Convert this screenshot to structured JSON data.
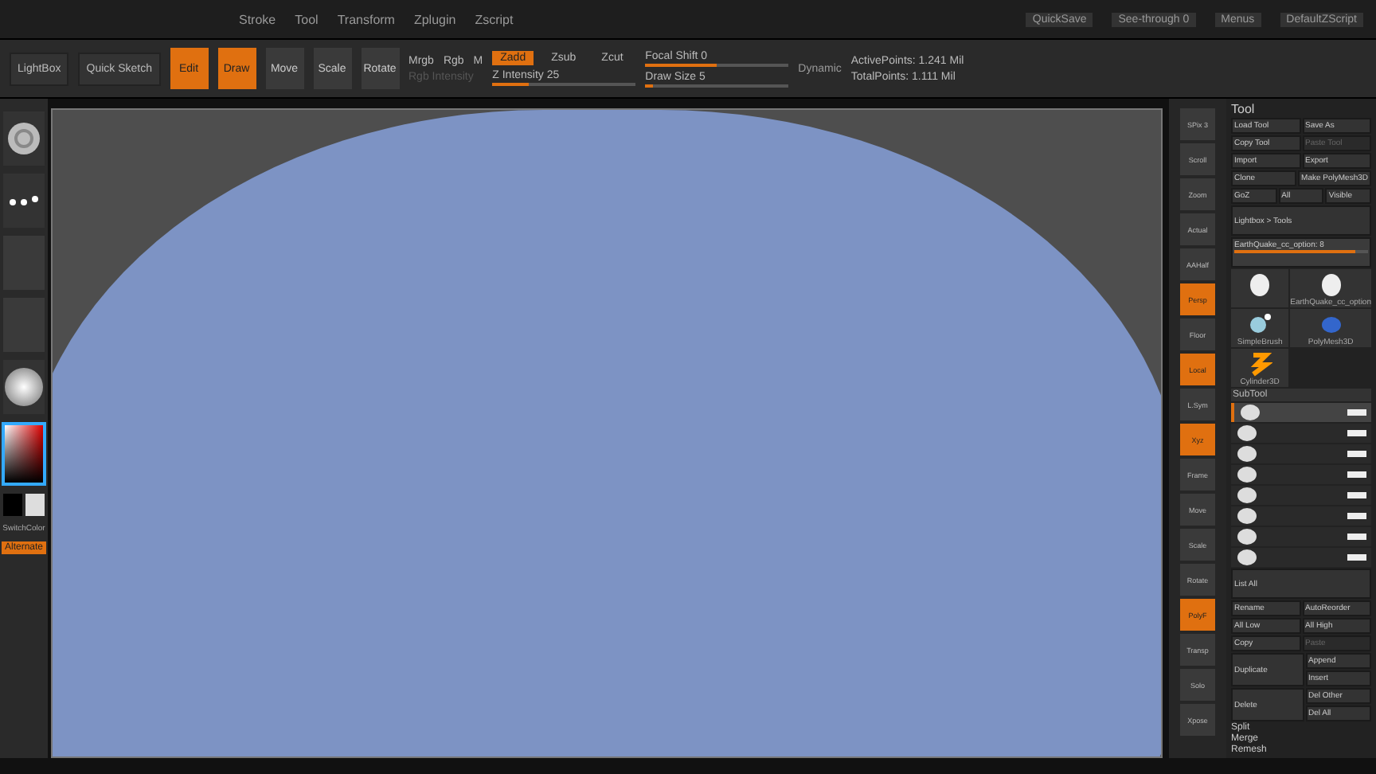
{
  "menu_bar": {
    "items": [
      "Stroke",
      "Tool",
      "Transform",
      "Zplugin",
      "Zscript"
    ],
    "right_items": [
      "QuickSave",
      "See-through 0",
      "Menus",
      "DefaultZScript"
    ]
  },
  "toolbar": {
    "home_buttons": [
      "LightBox",
      "Quick Sketch"
    ],
    "modes": [
      {
        "label": "Edit",
        "selected": true
      },
      {
        "label": "Draw",
        "selected": true
      },
      {
        "label": "Move",
        "selected": false
      },
      {
        "label": "Scale",
        "selected": false
      },
      {
        "label": "Rotate",
        "selected": false
      }
    ],
    "color_modes": [
      {
        "label": "Mrgb",
        "disabled": false
      },
      {
        "label": "Rgb",
        "disabled": false
      },
      {
        "label": "M",
        "disabled": false
      }
    ],
    "rgb_intensity": {
      "label": "Rgb Intensity",
      "disabled": true
    },
    "depth_modes": [
      {
        "label": "Zadd",
        "selected": true
      },
      {
        "label": "Zsub",
        "selected": false
      },
      {
        "label": "Zcut",
        "selected": false
      }
    ],
    "sliders": [
      {
        "label": "Focal Shift 0",
        "level": 0.5
      },
      {
        "label": "Z Intensity 25",
        "level": 0.25
      },
      {
        "label": "Draw Size 5",
        "level": 0.05
      }
    ],
    "dynamic": "Dynamic",
    "stats": [
      "ActivePoints: 1.241 Mil",
      "TotalPoints: 1.111 Mil"
    ]
  },
  "left_shelf": {
    "items": [
      {
        "kind": "brush"
      },
      {
        "kind": "stroke"
      },
      {
        "kind": "alpha"
      },
      {
        "kind": "texture"
      },
      {
        "kind": "material"
      },
      {
        "kind": "color"
      },
      {
        "kind": "swatches"
      }
    ],
    "switch_label": "SwitchColor",
    "alternate": "Alternate"
  },
  "right_shelf": {
    "buttons": [
      {
        "label": "SPix 3",
        "selected": false
      },
      {
        "label": "Scroll",
        "selected": false
      },
      {
        "label": "Zoom",
        "selected": false
      },
      {
        "label": "Actual",
        "selected": false
      },
      {
        "label": "AAHalf",
        "selected": false
      },
      {
        "label": "Persp",
        "selected": true
      },
      {
        "label": "Floor",
        "selected": false
      },
      {
        "label": "Local",
        "selected": true
      },
      {
        "label": "L.Sym",
        "selected": false
      },
      {
        "label": "Xyz",
        "selected": true
      },
      {
        "label": "Frame",
        "selected": false
      },
      {
        "label": "Move",
        "selected": false
      },
      {
        "label": "Scale",
        "selected": false
      },
      {
        "label": "Rotate",
        "selected": false
      },
      {
        "label": "PolyF",
        "selected": true
      },
      {
        "label": "Transp",
        "selected": false
      },
      {
        "label": "Solo",
        "selected": false
      },
      {
        "label": "Xpose",
        "selected": false
      }
    ]
  },
  "tool_panel": {
    "title": "Tool",
    "buttons": [
      [
        {
          "label": "Load Tool",
          "disabled": false
        },
        {
          "label": "Save As",
          "disabled": false
        }
      ],
      [
        {
          "label": "Copy Tool",
          "disabled": false
        },
        {
          "label": "Paste Tool",
          "disabled": true
        }
      ],
      [
        {
          "label": "Import",
          "disabled": false
        },
        {
          "label": "Export",
          "disabled": false
        }
      ],
      [
        {
          "label": "Clone",
          "disabled": false
        },
        {
          "label": "Make PolyMesh3D",
          "disabled": false
        }
      ],
      [
        {
          "label": "GoZ",
          "disabled": false
        },
        {
          "label": "All",
          "disabled": false
        },
        {
          "label": "Visible",
          "disabled": false
        }
      ]
    ],
    "lightbox_tools": "Lightbox > Tools",
    "current_tool": {
      "label": "EarthQuake_cc_option: 8",
      "level": 0.9
    },
    "tool_thumbnails": [
      {
        "kind": "figure"
      },
      {
        "kind": "figure",
        "label": "EarthQuake_cc_option"
      },
      {
        "kind": "spheres",
        "label": "SimpleBrush"
      },
      {
        "kind": "ball",
        "label": "PolyMesh3D"
      },
      {
        "kind": "star",
        "label": "Cylinder3D"
      }
    ],
    "subtool_title": "SubTool",
    "subtools": [
      {
        "selected": true,
        "visible": true
      },
      {
        "selected": false,
        "visible": true
      },
      {
        "selected": false,
        "visible": true
      },
      {
        "selected": false,
        "visible": true
      },
      {
        "selected": false,
        "visible": true
      },
      {
        "selected": false,
        "visible": true
      },
      {
        "selected": false,
        "visible": true
      },
      {
        "selected": false,
        "visible": true
      }
    ],
    "list_all": "List All",
    "actions": [
      [
        {
          "label": "Rename",
          "disabled": false
        },
        {
          "label": "AutoReorder",
          "disabled": false
        }
      ],
      [
        {
          "label": "All Low",
          "disabled": false
        },
        {
          "label": "All High",
          "disabled": false
        }
      ],
      [
        {
          "label": "Copy",
          "disabled": false
        },
        {
          "label": "Paste",
          "disabled": true
        }
      ]
    ],
    "duplicate": "Duplicate",
    "append": [
      "Append",
      "Insert"
    ],
    "delete": "Delete",
    "delete_options": [
      "Del Other",
      "Del All"
    ],
    "sections": [
      "Split",
      "Merge",
      "Remesh"
    ]
  }
}
